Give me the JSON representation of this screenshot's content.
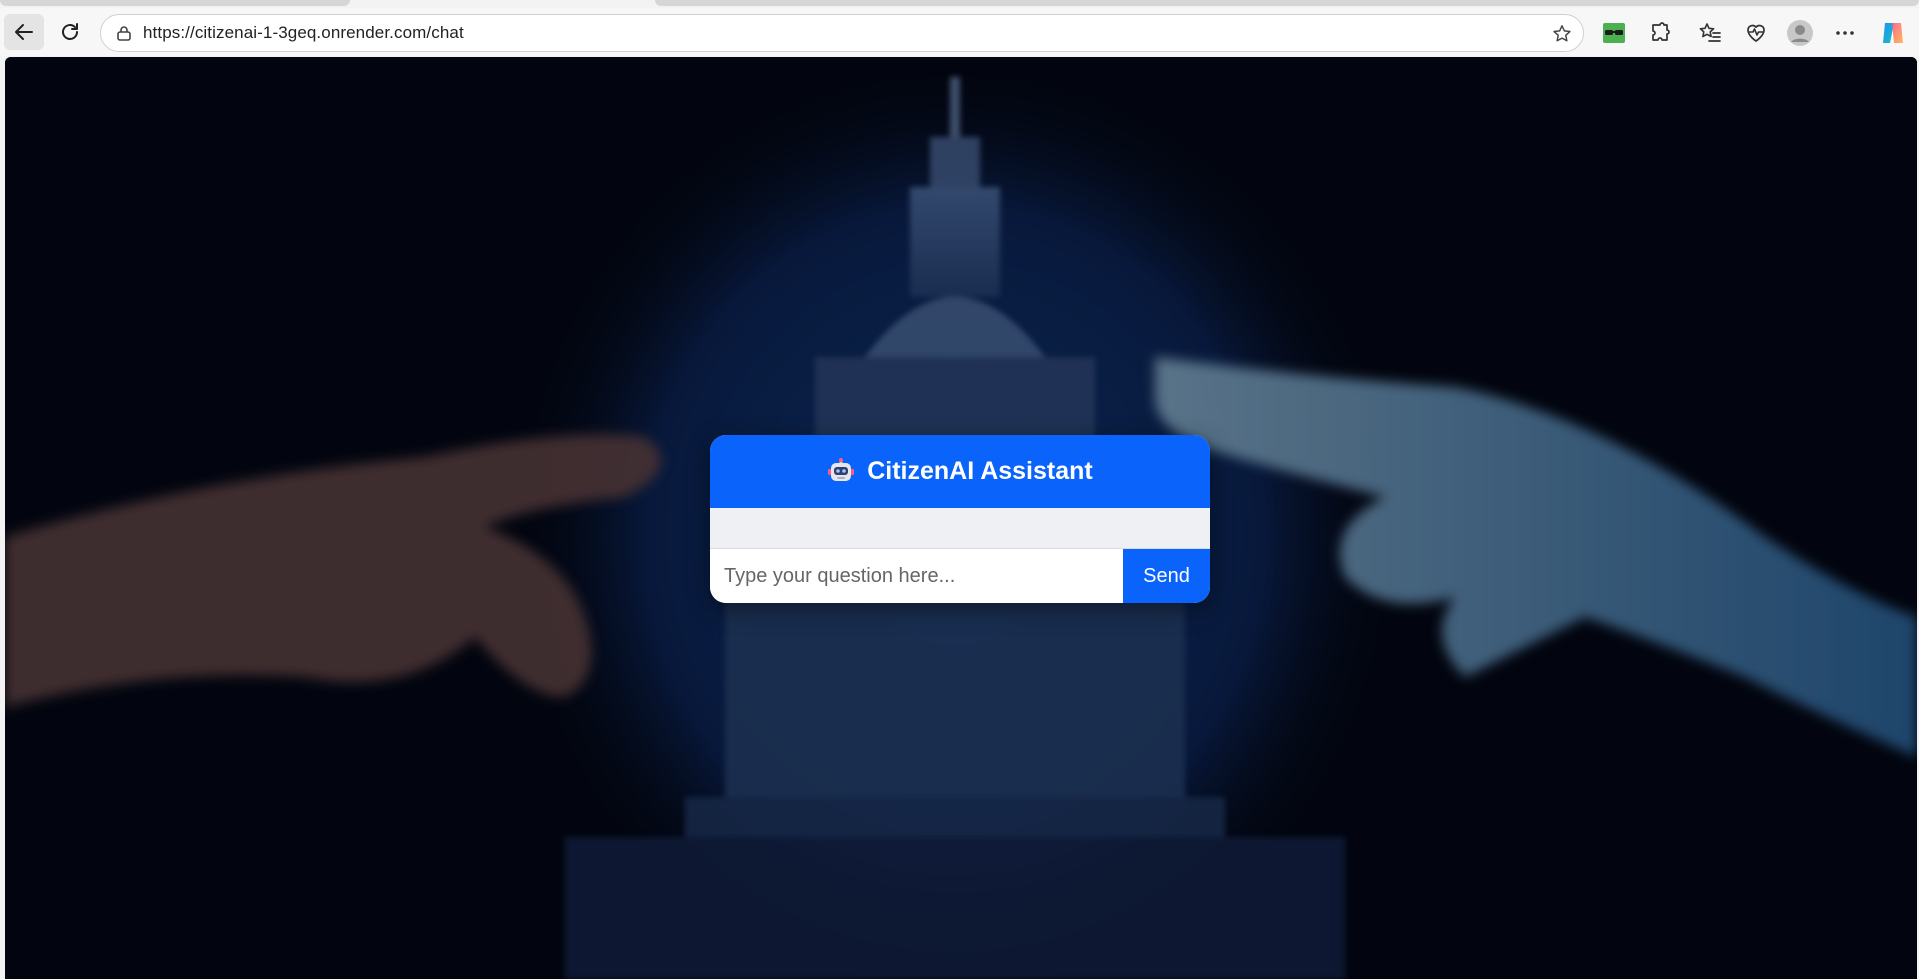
{
  "browser": {
    "url": "https://citizenai-1-3geq.onrender.com/chat",
    "toolbar_icons": [
      "back-arrow-icon",
      "reload-icon",
      "site-info-icon",
      "favorite-star-icon",
      "glasses-extension-icon",
      "puzzle-extensions-icon",
      "favorites-list-icon",
      "health-heart-icon",
      "profile-avatar-icon",
      "more-menu-icon",
      "copilot-icon"
    ]
  },
  "chat": {
    "title": "CitizenAI Assistant",
    "title_icon": "robot-icon",
    "input_placeholder": "Type your question here...",
    "send_label": "Send"
  },
  "colors": {
    "accent": "#0a63fa",
    "message_area": "#eef0f3",
    "page_background": "#03060f"
  }
}
